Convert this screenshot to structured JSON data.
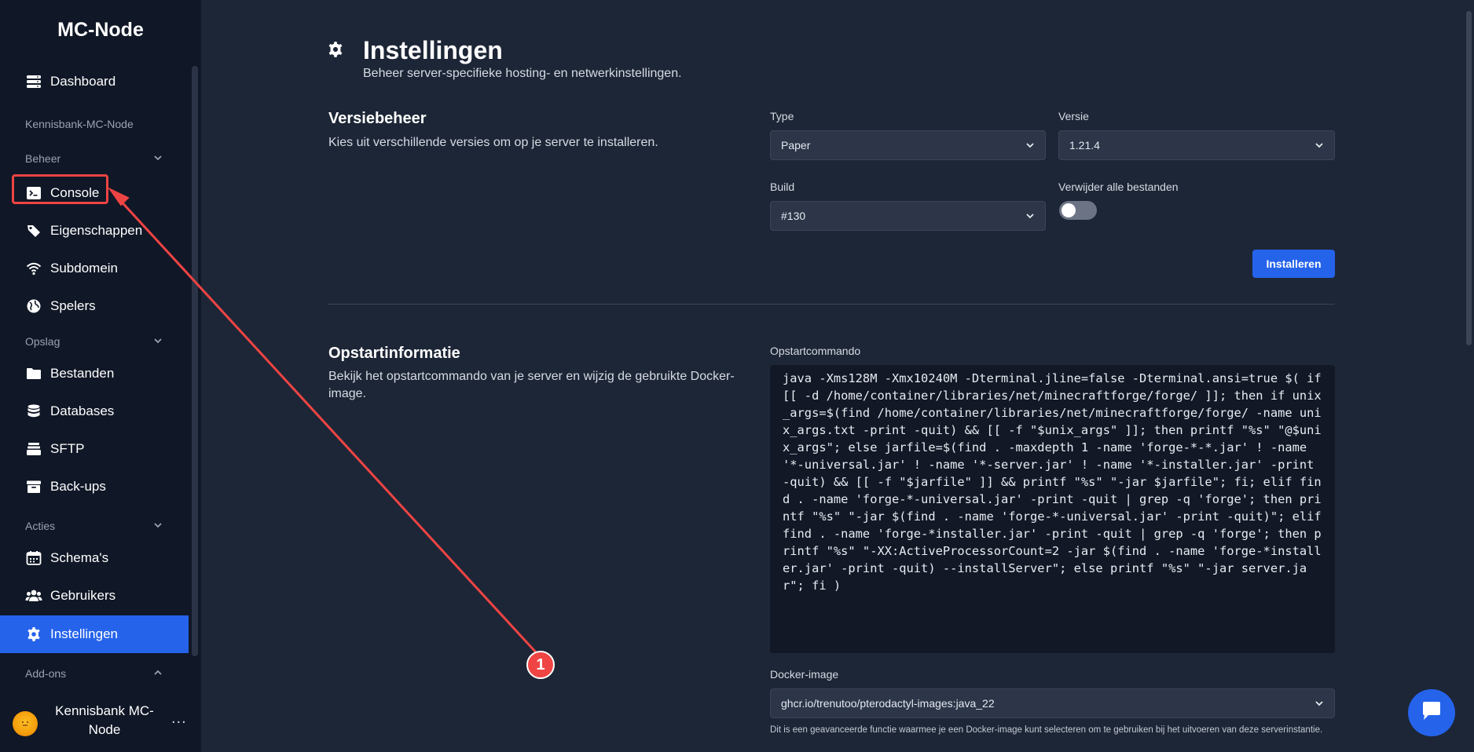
{
  "sidebar": {
    "brand": "MC-Node",
    "dashboard": "Dashboard",
    "server_name": "Kennisbank-MC-Node",
    "sections": {
      "beheer": "Beheer",
      "opslag": "Opslag",
      "acties": "Acties",
      "addons": "Add-ons"
    },
    "items": {
      "console": "Console",
      "eigenschappen": "Eigenschappen",
      "subdomein": "Subdomein",
      "spelers": "Spelers",
      "bestanden": "Bestanden",
      "databases": "Databases",
      "sftp": "SFTP",
      "backups": "Back-ups",
      "schemas": "Schema's",
      "gebruikers": "Gebruikers",
      "instellingen": "Instellingen"
    },
    "user": {
      "name": "Kennisbank MC-Node",
      "more": "..."
    }
  },
  "page": {
    "title": "Instellingen",
    "subtitle": "Beheer server-specifieke hosting- en netwerkinstellingen."
  },
  "version_section": {
    "title": "Versiebeheer",
    "description": "Kies uit verschillende versies om op je server te installeren.",
    "type_label": "Type",
    "type_value": "Paper",
    "version_label": "Versie",
    "version_value": "1.21.4",
    "build_label": "Build",
    "build_value": "#130",
    "wipe_label": "Verwijder alle bestanden",
    "wipe_enabled": false,
    "install_button": "Installeren"
  },
  "startup_section": {
    "title": "Opstartinformatie",
    "description": "Bekijk het opstartcommando van je server en wijzig de gebruikte Docker-image.",
    "command_label": "Opstartcommando",
    "command": "java -Xms128M -Xmx10240M -Dterminal.jline=false -Dterminal.ansi=true $( if [[ -d /home/container/libraries/net/minecraftforge/forge/ ]]; then if unix_args=$(find /home/container/libraries/net/minecraftforge/forge/ -name unix_args.txt -print -quit) && [[ -f \"$unix_args\" ]]; then printf \"%s\" \"@$unix_args\"; else jarfile=$(find . -maxdepth 1 -name 'forge-*-*.jar' ! -name '*-universal.jar' ! -name '*-server.jar' ! -name '*-installer.jar' -print -quit) && [[ -f \"$jarfile\" ]] && printf \"%s\" \"-jar $jarfile\"; fi; elif find . -name 'forge-*-universal.jar' -print -quit | grep -q 'forge'; then printf \"%s\" \"-jar $(find . -name 'forge-*-universal.jar' -print -quit)\"; elif find . -name 'forge-*installer.jar' -print -quit | grep -q 'forge'; then printf \"%s\" \"-XX:ActiveProcessorCount=2 -jar $(find . -name 'forge-*installer.jar' -print -quit) --installServer\"; else printf \"%s\" \"-jar server.jar\"; fi )",
    "docker_label": "Docker-image",
    "docker_value": "ghcr.io/trenutoo/pterodactyl-images:java_22",
    "docker_note": "Dit is een geavanceerde functie waarmee je een Docker-image kunt selecteren om te gebruiken bij het uitvoeren van deze serverinstantie."
  },
  "annotation": {
    "step": "1",
    "color": "#ef4444"
  },
  "colors": {
    "accent": "#2563eb",
    "sidebar_bg": "#101726",
    "main_bg": "#1d2636"
  }
}
